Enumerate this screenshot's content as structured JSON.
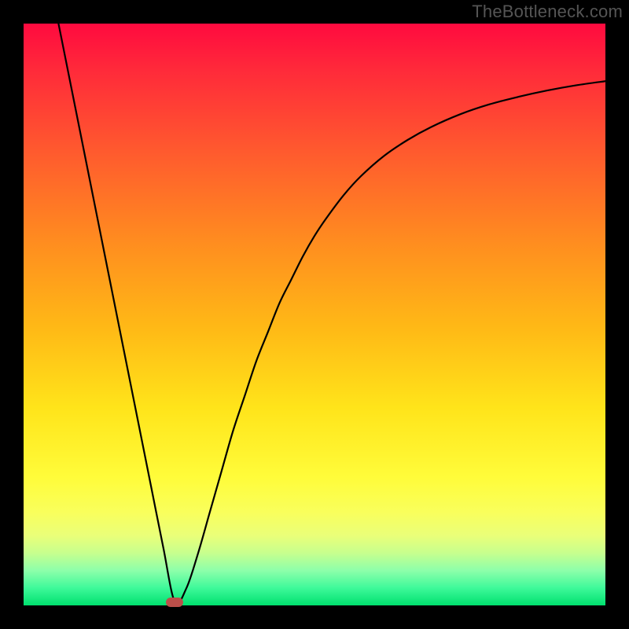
{
  "watermark_text": "TheBottleneck.com",
  "chart_data": {
    "type": "line",
    "title": "",
    "xlabel": "",
    "ylabel": "",
    "xlim": [
      0,
      100
    ],
    "ylim": [
      0,
      100
    ],
    "legend": false,
    "annotations": [
      {
        "type": "marker",
        "shape": "rounded-rect",
        "color": "#bb4f4a",
        "x": 26,
        "y": 0.6
      }
    ],
    "series": [
      {
        "name": "curve",
        "x": [
          6,
          8,
          10,
          12,
          14,
          16,
          18,
          20,
          22,
          24,
          26,
          28,
          30,
          32,
          34,
          36,
          38,
          40,
          42,
          44,
          46,
          48,
          50,
          52,
          55,
          58,
          62,
          66,
          70,
          75,
          80,
          85,
          90,
          95,
          100
        ],
        "y": [
          100,
          90,
          80,
          70,
          60,
          50,
          40,
          30,
          20,
          10,
          0.6,
          3,
          9,
          16,
          23,
          30,
          36,
          42,
          47,
          52,
          56,
          60,
          63.5,
          66.5,
          70.5,
          73.8,
          77.3,
          80,
          82.2,
          84.4,
          86.1,
          87.4,
          88.5,
          89.4,
          90.1
        ]
      }
    ],
    "background": {
      "type": "vertical-gradient",
      "stops": [
        {
          "pos": 0,
          "color": "#ff0a3f"
        },
        {
          "pos": 22,
          "color": "#ff5a2e"
        },
        {
          "pos": 52,
          "color": "#ffb816"
        },
        {
          "pos": 78,
          "color": "#fffc3a"
        },
        {
          "pos": 100,
          "color": "#00e06e"
        }
      ]
    }
  }
}
